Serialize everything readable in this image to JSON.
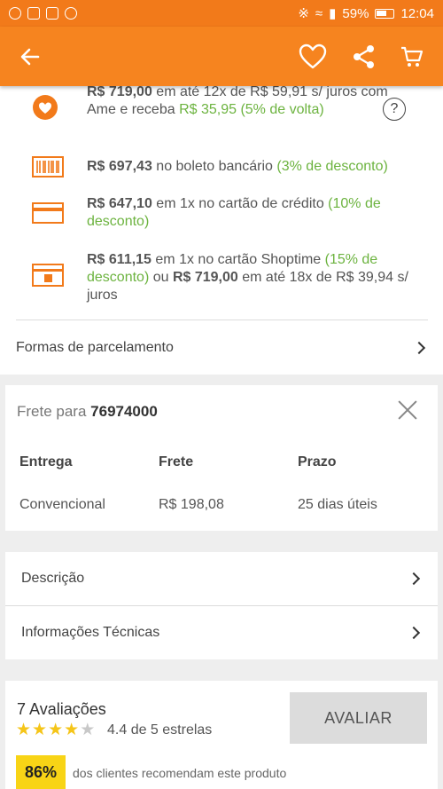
{
  "status_bar": {
    "battery": "59%",
    "time": "12:04"
  },
  "payments": [
    {
      "amount": "R$ 719,00",
      "text": " em até 12x de R$ 59,91 s/ juros com Ame e receba ",
      "highlight": "R$ 35,95 (5% de volta)",
      "icon": "ame-heart-icon"
    },
    {
      "amount": "R$ 697,43",
      "text": " no boleto bancário ",
      "highlight": "(3% de desconto)",
      "icon": "barcode-icon"
    },
    {
      "amount": "R$ 647,10",
      "text": " em 1x no cartão de crédito ",
      "highlight": "(10% de desconto)",
      "icon": "credit-card-icon"
    },
    {
      "amount": "R$ 611,15",
      "text": " em 1x no cartão Shoptime ",
      "highlight": "(15% de desconto)",
      "text2": " ou ",
      "amount2": "R$ 719,00",
      "text3": " em até 18x de R$ 39,94 s/ juros",
      "icon": "shoptime-card-icon"
    }
  ],
  "installments_label": "Formas de parcelamento",
  "shipping": {
    "title_prefix": "Frete para ",
    "cep": "76974000",
    "headers": [
      "Entrega",
      "Frete",
      "Prazo"
    ],
    "row": [
      "Convencional",
      "R$ 198,08",
      "25 dias úteis"
    ]
  },
  "info": {
    "description": "Descrição",
    "technical": "Informações Técnicas"
  },
  "reviews": {
    "count_label": "7 Avaliações",
    "rating": 4.4,
    "rating_label": "4.4 de 5 estrelas",
    "button": "AVALIAR",
    "recommend_pct": "86%",
    "recommend_text": "dos clientes recomendam este produto"
  },
  "colors": {
    "brand_orange": "#f6841f",
    "discount_green": "#6cb33f",
    "badge_yellow": "#f8d416"
  }
}
